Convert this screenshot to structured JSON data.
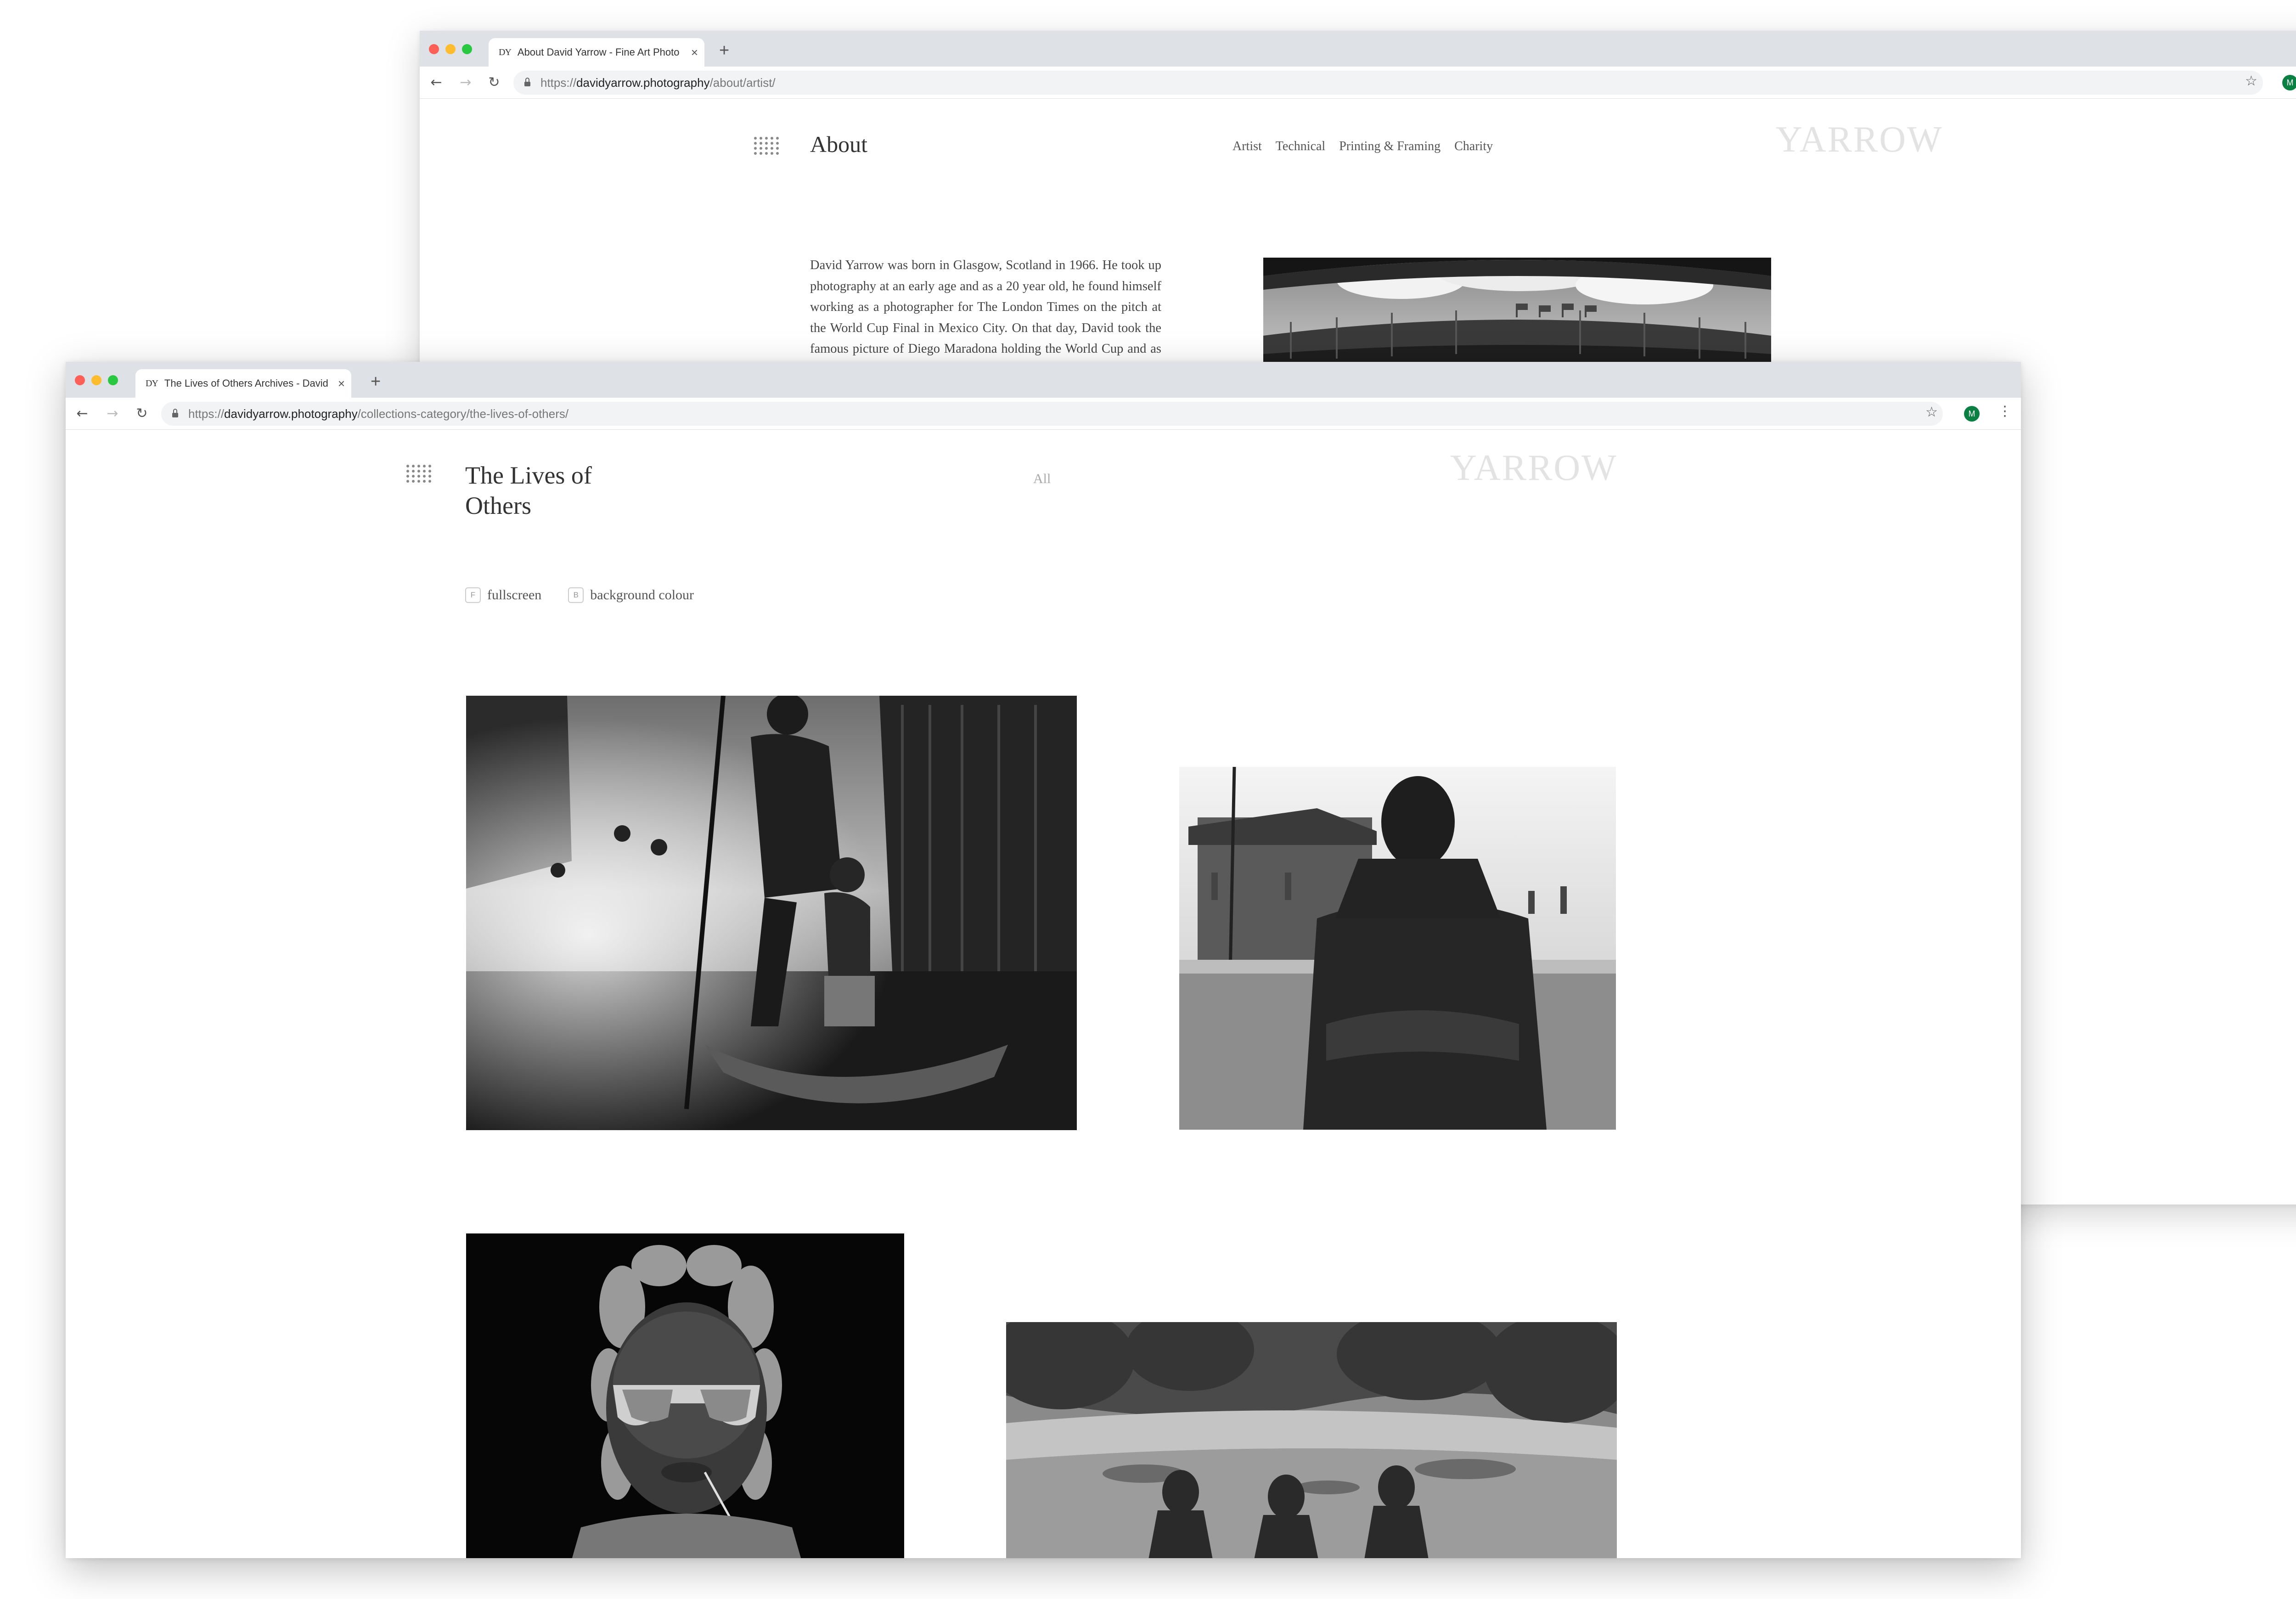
{
  "colors": {
    "tab_bar": "#dee1e6",
    "close_light": "#fe5f57",
    "minimize_light": "#febc2e",
    "zoom_light": "#28c840",
    "avatar": "#0b8043",
    "logo": "#e3e3e3"
  },
  "back_window": {
    "tab": {
      "favicon": "DY",
      "title": "About David Yarrow - Fine Art Photo"
    },
    "address": {
      "protocol": "https://",
      "host": "davidyarrow.photography",
      "path": "/about/artist/"
    },
    "avatar_initial": "M",
    "page": {
      "title": "About",
      "nav": [
        "Artist",
        "Technical",
        "Printing & Framing",
        "Charity"
      ],
      "logo": "YARROW",
      "body_text": "David Yarrow was born in Glasgow, Scotland in 1966. He took up photography at an early age and as a 20 year old, he found himself working as a photographer for The London Times on the pitch at the World Cup Final in Mexico City. On that day, David took the famous picture of Diego Maradona holding the World Cup and as a result, he was subsequently asked to cover the Olympics and numerous"
    }
  },
  "front_window": {
    "tab": {
      "favicon": "DY",
      "title": "The Lives of Others Archives - David"
    },
    "address": {
      "protocol": "https://",
      "host": "davidyarrow.photography",
      "path": "/collections-category/the-lives-of-others/"
    },
    "avatar_initial": "M",
    "page": {
      "title_line1": "The Lives of",
      "title_line2": "Others",
      "filter": "All",
      "logo": "YARROW",
      "tools": [
        {
          "key": "F",
          "label": "fullscreen"
        },
        {
          "key": "B",
          "label": "background colour"
        }
      ]
    }
  },
  "icons": {
    "menu": "grid-menu-icon",
    "back": "back-arrow-icon",
    "forward": "forward-arrow-icon",
    "reload": "reload-icon",
    "lock": "lock-icon",
    "bookmark": "star-icon",
    "more": "kebab-menu-icon",
    "close": "close-icon",
    "new_tab": "plus-icon"
  }
}
